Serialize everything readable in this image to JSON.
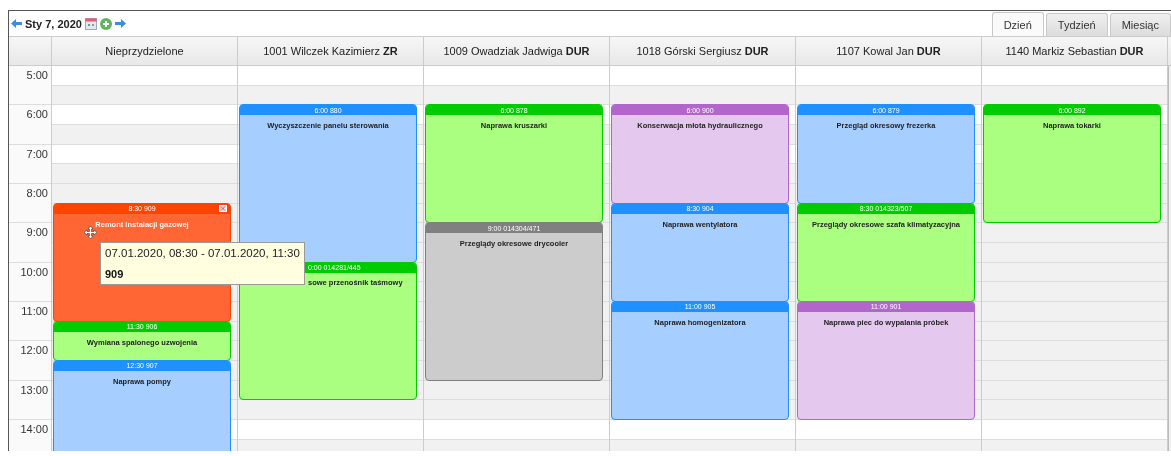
{
  "toolbar": {
    "date": "Sty 7, 2020"
  },
  "view_tabs": [
    {
      "label": "Dzień",
      "selected": true
    },
    {
      "label": "Tydzień",
      "selected": false
    },
    {
      "label": "Miesiąc",
      "selected": false
    }
  ],
  "hours": [
    "5:00",
    "6:00",
    "7:00",
    "8:00",
    "9:00",
    "10:00",
    "11:00",
    "12:00",
    "13:00",
    "14:00"
  ],
  "columns": [
    {
      "title": "Nieprzydzielone",
      "events": [
        {
          "header": "8:30 909",
          "title": "Remont instalacji gazowej",
          "color": "#ff4400",
          "closable": true,
          "covered": false
        },
        {
          "header": "11:30 906",
          "title": "Wymiana spalonego uzwojenia",
          "color": "#00cc00",
          "closable": false,
          "covered": false
        },
        {
          "header": "12:30 907",
          "title": "Naprawa pompy",
          "color": "#1e90ff",
          "closable": false,
          "covered": false
        }
      ]
    },
    {
      "title": "1001 Wilczek Kazimierz **ZR**",
      "events": [
        {
          "header": "6:00 880",
          "title": "Wyczyszczenie panelu sterowania",
          "color": "#1e90ff",
          "closable": false,
          "covered": false
        },
        {
          "header": "0:00 014281/445",
          "title": "sowe przenośnik taśmowy",
          "color": "#00cc00",
          "closable": false,
          "covered": true
        }
      ]
    },
    {
      "title": "1009 Owadziak Jadwiga **DUR**",
      "events": [
        {
          "header": "6:00 878",
          "title": "Naprawa kruszarki",
          "color": "#00cc00",
          "closable": false,
          "covered": false
        },
        {
          "header": "9:00 014304/471",
          "title": "Przeglądy okresowe drycooler",
          "color": "#808080",
          "closable": false,
          "covered": false
        }
      ]
    },
    {
      "title": "1018 Górski Sergiusz **DUR**",
      "events": [
        {
          "header": "6:00 900",
          "title": "Konserwacja młota hydraulicznego",
          "color": "#b266cc",
          "closable": false,
          "covered": false
        },
        {
          "header": "8:30 904",
          "title": "Naprawa wentylatora",
          "color": "#1e90ff",
          "closable": false,
          "covered": false
        },
        {
          "header": "11:00 905",
          "title": "Naprawa homogenizatora",
          "color": "#1e90ff",
          "closable": false,
          "covered": false
        }
      ]
    },
    {
      "title": "1107 Kowal Jan **DUR**",
      "events": [
        {
          "header": "6:00 879",
          "title": "Przegląd okresowy frezerka",
          "color": "#1e90ff",
          "closable": false,
          "covered": false
        },
        {
          "header": "8:30 014323/507",
          "title": "Przeglądy okresowe szafa klimatyzacyjna",
          "color": "#00cc00",
          "closable": false,
          "covered": false
        },
        {
          "header": "11:00 901",
          "title": "Naprawa piec do wypalania próbek",
          "color": "#b266cc",
          "closable": false,
          "covered": false
        }
      ]
    },
    {
      "title": "1140 Markiz Sebastian **DUR**",
      "events": [
        {
          "header": "6:00 892",
          "title": "Naprawa tokarki",
          "color": "#00cc00",
          "closable": false,
          "covered": false
        }
      ]
    }
  ],
  "tooltip": {
    "range": "07.01.2020, 08:30 - 07.01.2020, 11:30",
    "number": "909"
  }
}
